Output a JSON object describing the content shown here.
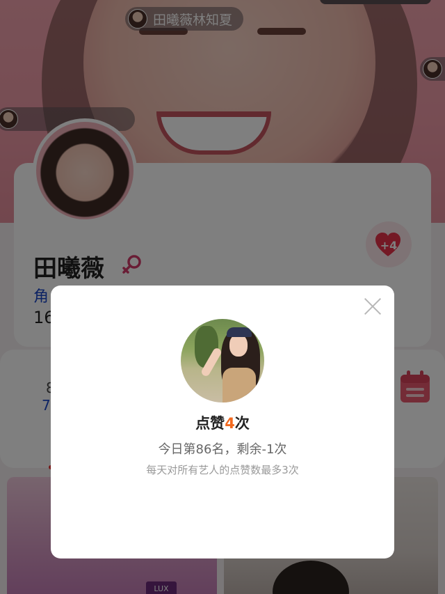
{
  "hero": {
    "danmaku": [
      {
        "text": "田曦薇林知夏"
      },
      {
        "text": ""
      },
      {
        "text": ""
      }
    ]
  },
  "profile": {
    "name": "田曦薇",
    "gender_icon": "female-icon",
    "like_count": "+4",
    "role_label_partial": "角",
    "stat_partial": "16"
  },
  "info": {
    "line1_partial": "",
    "line2_partial": "8",
    "line3_partial": "7",
    "calendar_icon": "calendar-icon"
  },
  "photos": {
    "photo1_tag": "LUX"
  },
  "modal": {
    "title_prefix": "点赞",
    "title_count": "4",
    "title_suffix": "次",
    "rank_text": "今日第86名，剩余-1次",
    "note": "每天对所有艺人的点赞数最多3次",
    "close_icon": "close-icon"
  },
  "colors": {
    "accent_orange": "#f36a1f",
    "heart_red": "#e8334a",
    "link_blue": "#1b47c9",
    "overlay": "rgba(0,0,0,0.5)"
  }
}
